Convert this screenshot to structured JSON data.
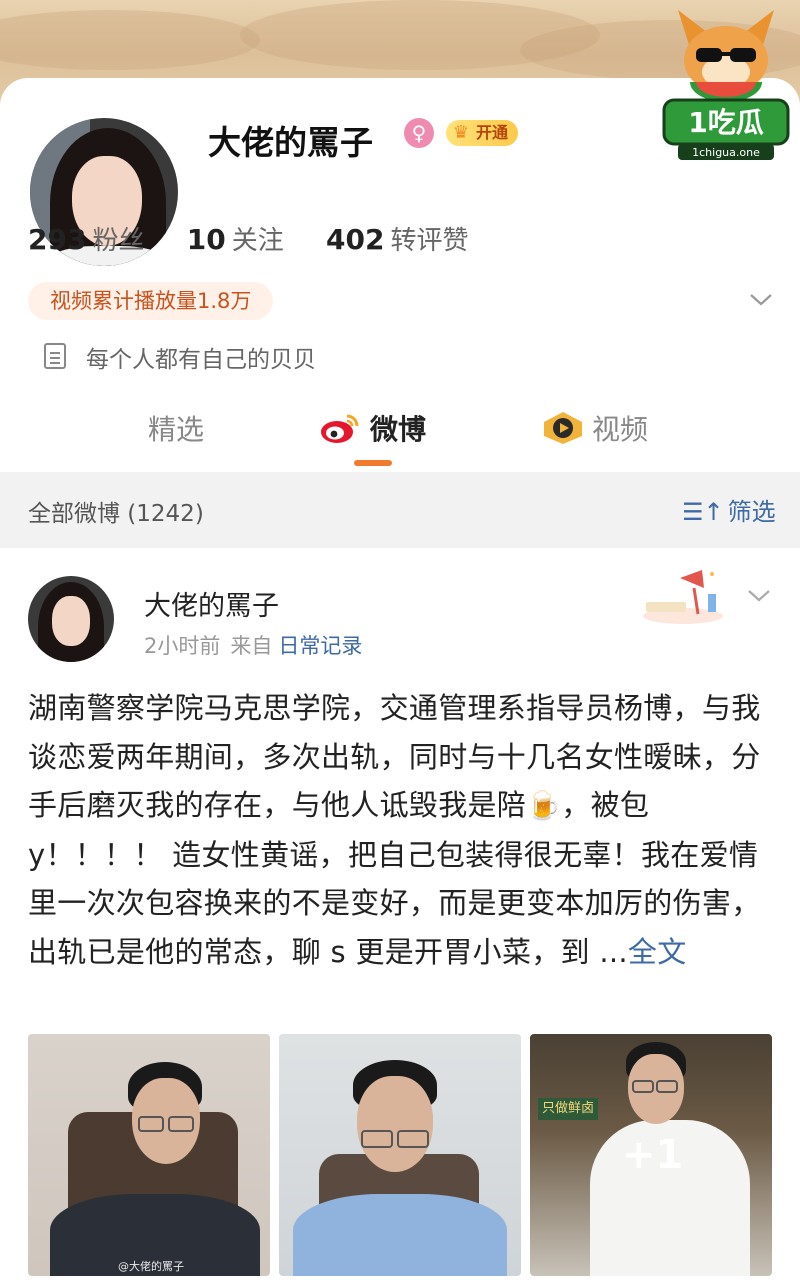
{
  "profile": {
    "username": "大佬的罵子",
    "gender_icon": "female-icon",
    "vip_label": "开通",
    "stats": [
      {
        "value": "293",
        "label": "粉丝"
      },
      {
        "value": "10",
        "label": "关注"
      },
      {
        "value": "402",
        "label": "转评赞"
      }
    ],
    "video_plays": "视频累计播放量1.8万",
    "bio": "每个人都有自己的贝贝"
  },
  "tabs": [
    {
      "label": "精选"
    },
    {
      "label": "微博"
    },
    {
      "label": "视频"
    }
  ],
  "filter": {
    "title": "全部微博 (1242)",
    "button_label": "筛选"
  },
  "post": {
    "author": "大佬的罵子",
    "time": "2小时前",
    "from_label": "来自",
    "source": "日常记录",
    "text_part1": "湖南警察学院马克思学院，交通管理系指导员杨博，与我谈恋爱两年期间，多次出轨，同时与十几名女性暧昧，分手后磨灭我的存在，与他人诋毁我是陪",
    "text_part2": "，被包y！！！！ 造女性黄谣，把自己包装得很无辜！我在爱情里一次次包容换来的不是变好，而是更变本加厉的伤害，出轨已是他的常态，聊 s 更是开胃小菜，到 ...",
    "more_label": "全文",
    "image_more_count": "+1",
    "watermark": "@大佬的罵子",
    "shop_sign": "只做鲜卤"
  },
  "brand": {
    "text": "1吃瓜",
    "domain": "1chigua.one"
  },
  "colors": {
    "accent": "#f07b30",
    "link": "#3e6aa5",
    "filter_bg": "#f2f2f2"
  }
}
